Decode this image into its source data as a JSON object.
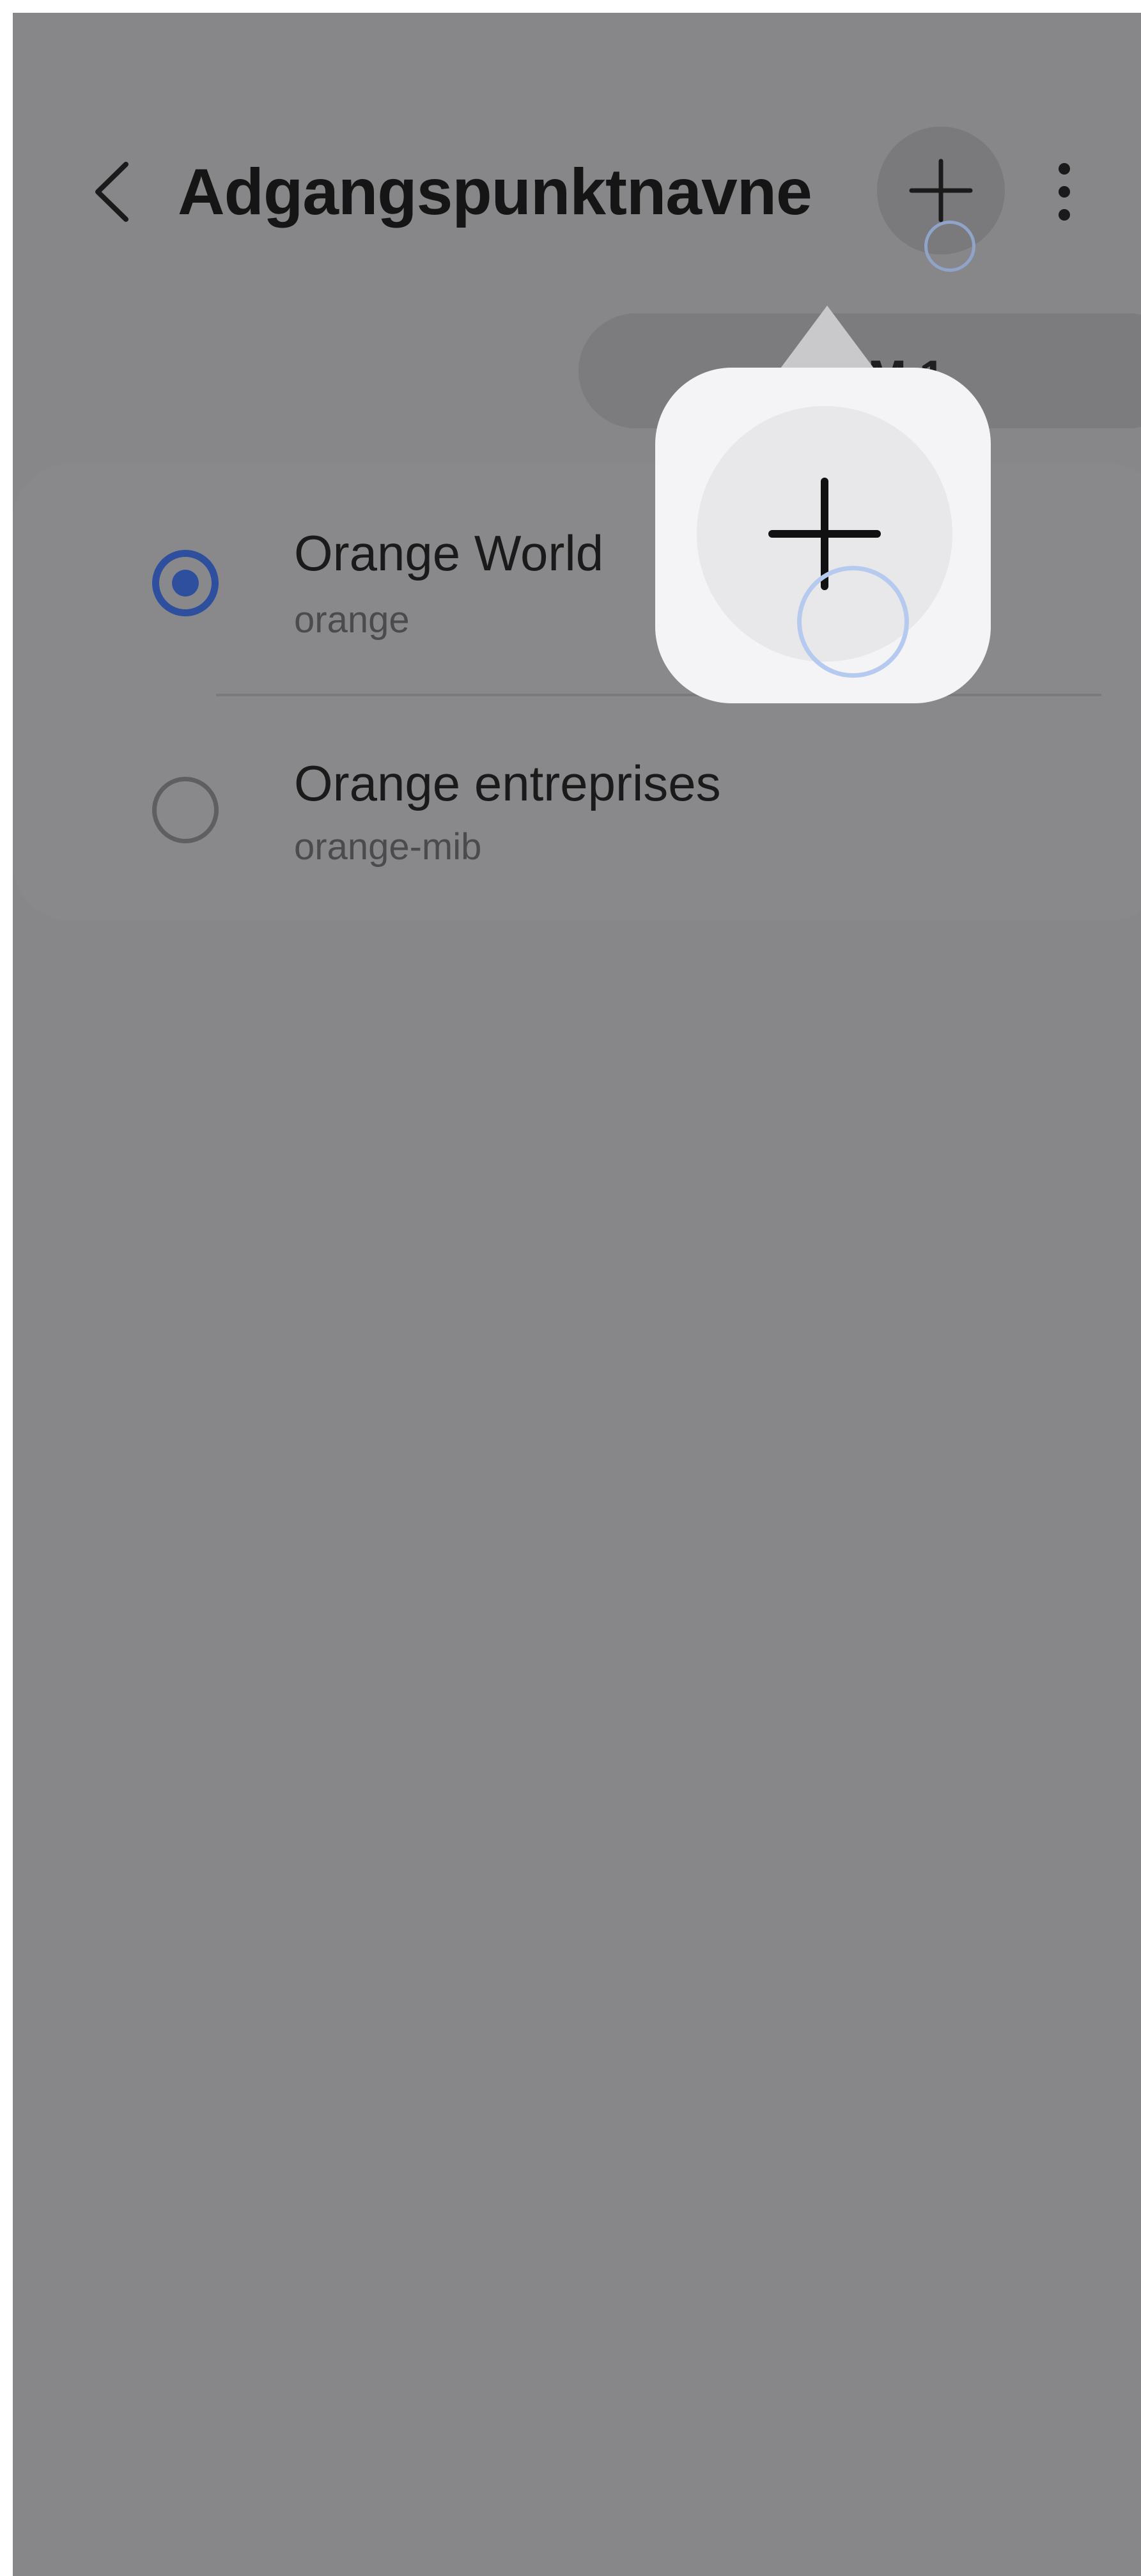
{
  "header": {
    "title": "Adgangspunktnavne",
    "back_icon": "chevron-left-icon",
    "add_icon": "plus-icon",
    "more_icon": "more-vertical-icon"
  },
  "sim_tab": {
    "label": "SIM 1"
  },
  "apn_list": [
    {
      "name": "Orange World",
      "apn": "orange",
      "selected": true
    },
    {
      "name": "Orange entreprises",
      "apn": "orange-mib",
      "selected": false
    }
  ],
  "callout": {
    "icon": "plus-icon"
  },
  "colors": {
    "overlay": "#878789",
    "radio_selected": "#2d4f9e",
    "tap_indicator": "#b6c9ee",
    "callout_background": "#f4f4f7"
  }
}
